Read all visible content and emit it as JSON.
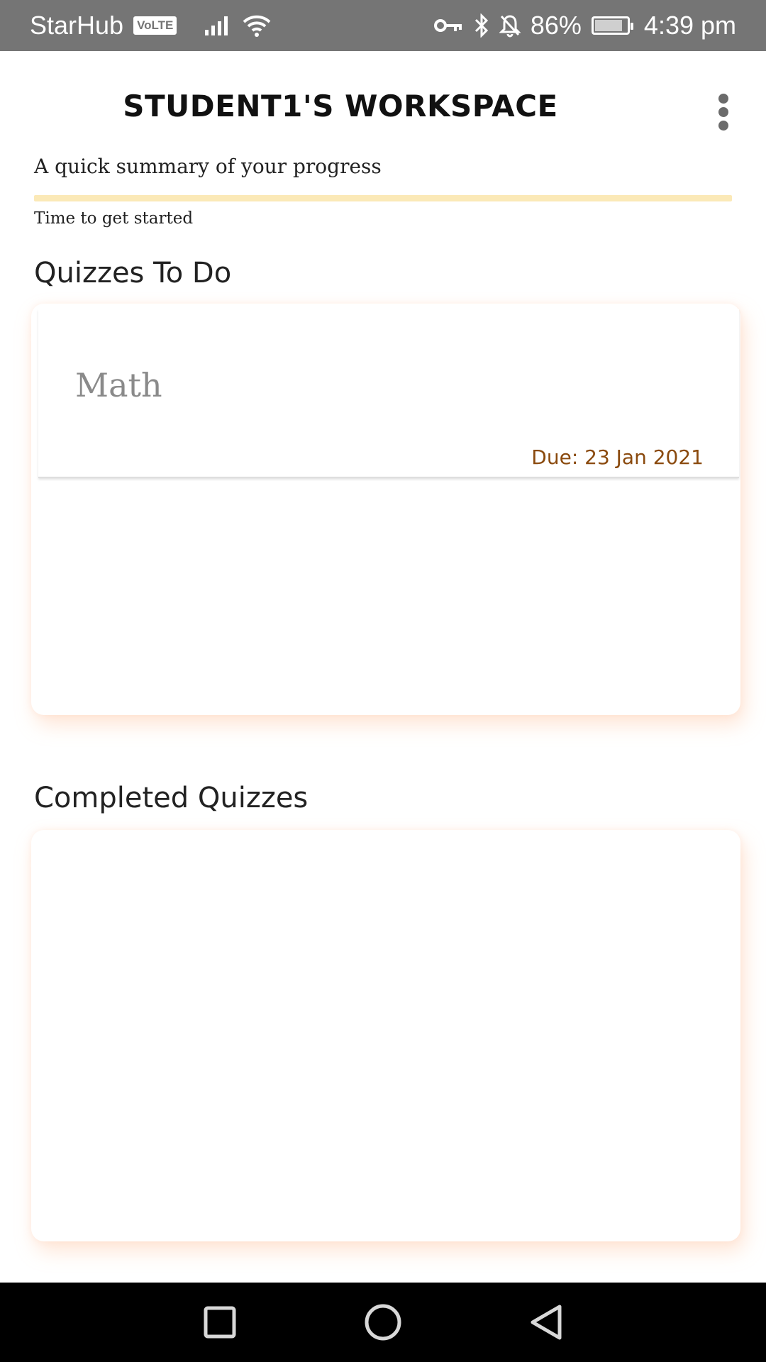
{
  "status_bar": {
    "carrier": "StarHub",
    "volte": "VoLTE",
    "battery": "86%",
    "time": "4:39 pm"
  },
  "header": {
    "title": "STUDENT1'S WORKSPACE",
    "subtitle": "A quick summary of your progress",
    "progress": 0,
    "progress_caption": "Time to get started"
  },
  "sections": {
    "todo_title": "Quizzes To Do",
    "completed_title": "Completed Quizzes"
  },
  "quizzes_todo": [
    {
      "subject": "Math",
      "due": "Due: 23 Jan 2021"
    }
  ],
  "colors": {
    "status_bar": "#757575",
    "progress_track": "#fbe9b7",
    "due_text": "#8a4a0e",
    "panel_shadow": "#ffb88c"
  },
  "icons": {
    "nav": [
      "recents-square-icon",
      "home-circle-icon",
      "back-triangle-icon"
    ]
  }
}
